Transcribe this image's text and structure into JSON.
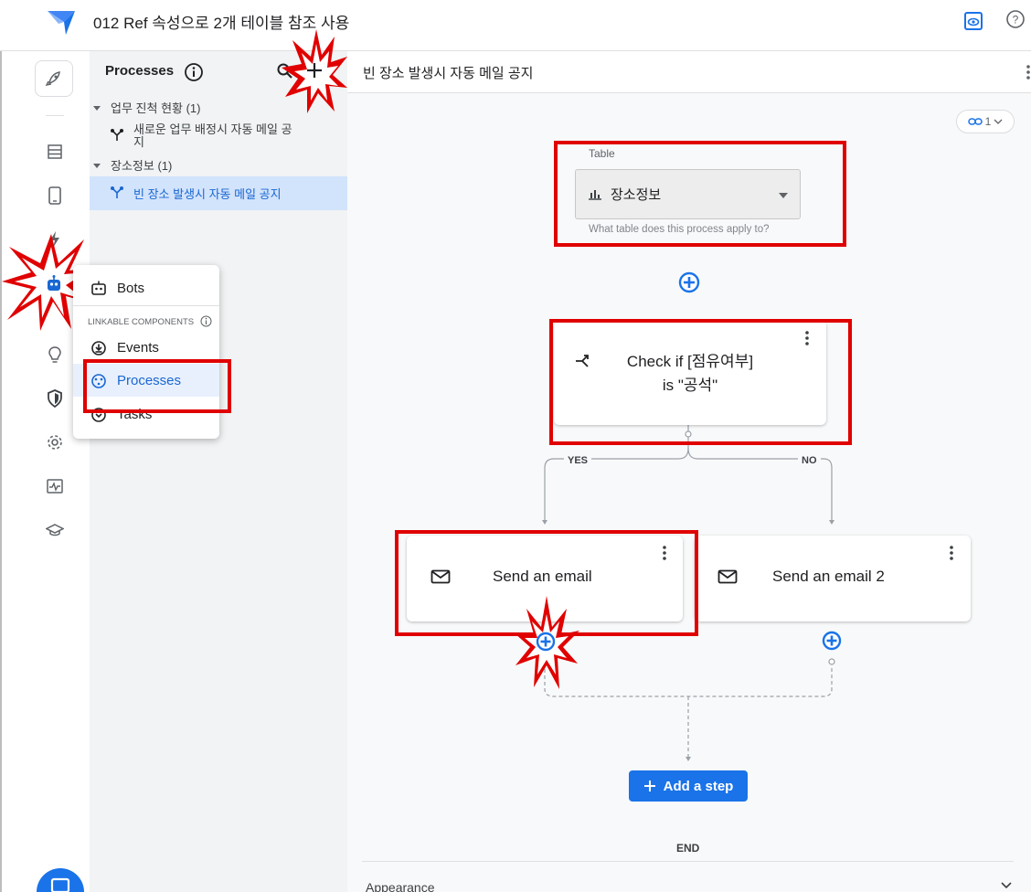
{
  "header": {
    "app_title": "012 Ref 속성으로 2개 테이블 참조 사용",
    "logo_icon": "appsheet-logo-icon",
    "preview_icon": "preview-icon",
    "help_icon": "help-icon"
  },
  "rail": {
    "items": [
      "launch-icon",
      "data-icon",
      "views-icon",
      "actions-icon",
      "automation-icon",
      "intelligence-icon",
      "security-icon",
      "settings-icon",
      "monitor-icon",
      "learn-icon"
    ]
  },
  "processes_panel": {
    "title": "Processes",
    "tree": [
      {
        "group": "업무 진척 현황 (1)",
        "items": [
          {
            "label_line1": "새로운 업무 배정시 자동 메일 공",
            "label_line2": "지"
          }
        ]
      },
      {
        "group": "장소정보 (1)",
        "items": [
          {
            "label": "빈 장소 발생시 자동 메일 공지"
          }
        ]
      }
    ]
  },
  "flyout_menu": {
    "bots": "Bots",
    "section_title": "LINKABLE COMPONENTS",
    "events": "Events",
    "processes": "Processes",
    "tasks": "Tasks"
  },
  "main": {
    "process_title": "빈 장소 발생시 자동 메일 공지",
    "link_count": "1",
    "table": {
      "label": "Table",
      "value": "장소정보",
      "hint": "What table does this process apply to?"
    },
    "condition": {
      "line1": "Check if [점유여부]",
      "line2": "is \"공석\""
    },
    "branch_yes": "YES",
    "branch_no": "NO",
    "email_step_1": "Send an email",
    "email_step_2": "Send an email 2",
    "add_step_label": "Add a step",
    "end_label": "END",
    "appearance_label": "Appearance"
  },
  "colors": {
    "accent": "#1a73e8",
    "highlight_box": "#e00000",
    "selected_bg": "#d2e3fc"
  }
}
